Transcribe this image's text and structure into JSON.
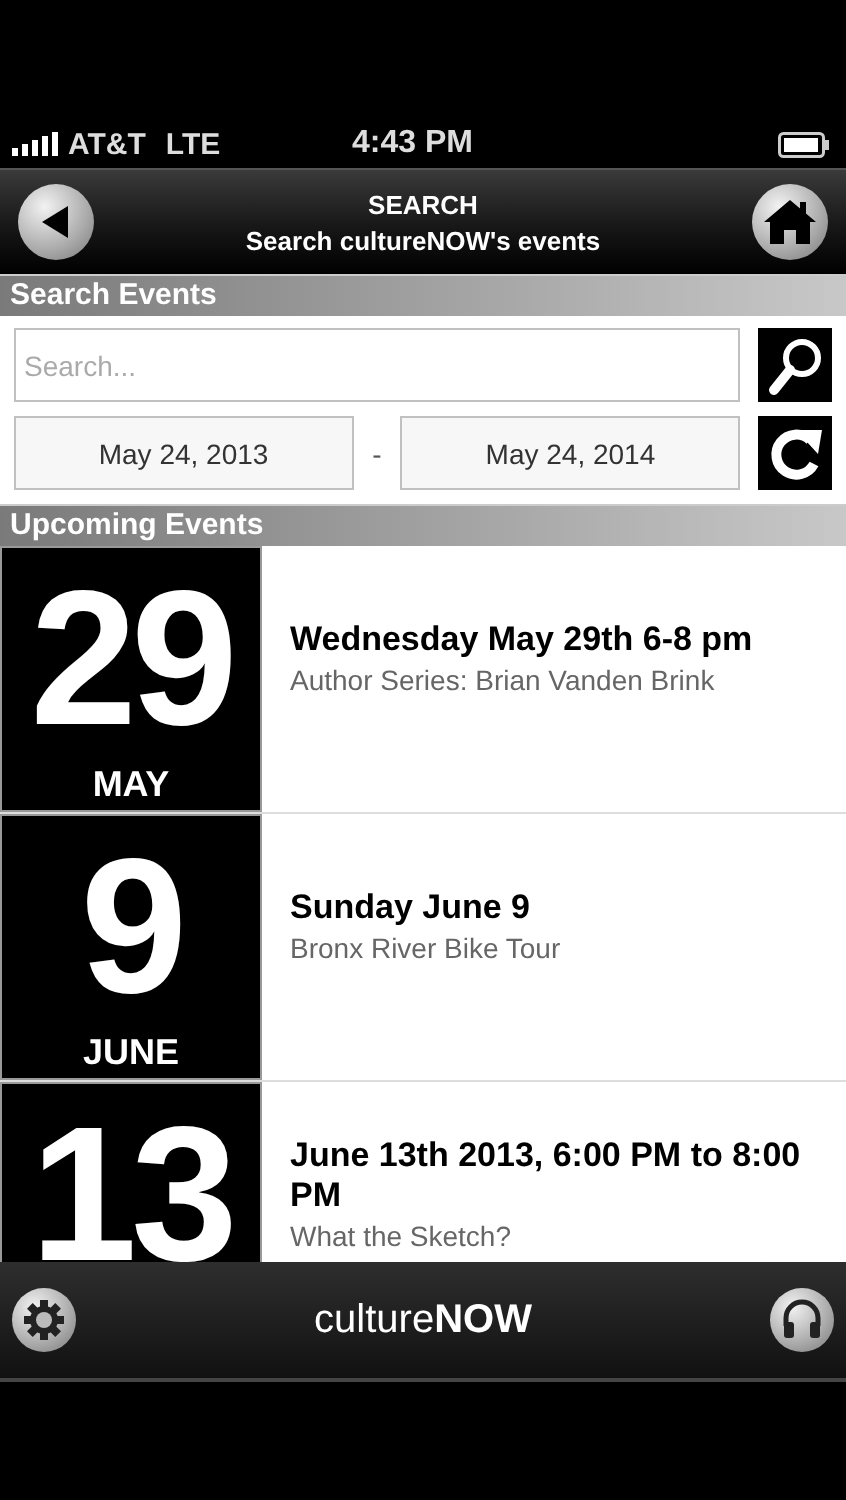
{
  "status_bar": {
    "carrier": "AT&T",
    "network": "LTE",
    "time": "4:43 PM"
  },
  "nav_bar": {
    "title": "SEARCH",
    "subtitle": "Search cultureNOW's events"
  },
  "search_section": {
    "heading": "Search Events",
    "search": {
      "placeholder": "Search..."
    },
    "date_from": "May 24, 2013",
    "separator": "-",
    "date_to": "May 24, 2014"
  },
  "events_section": {
    "heading": "Upcoming Events",
    "events": [
      {
        "day": "29",
        "month": "MAY",
        "title": "Wednesday May 29th 6-8 pm",
        "subtitle": "Author Series: Brian Vanden Brink"
      },
      {
        "day": "9",
        "month": "JUNE",
        "title": "Sunday June 9",
        "subtitle": "Bronx River Bike Tour"
      },
      {
        "day": "13",
        "title": "June 13th 2013, 6:00 PM to 8:00 PM",
        "subtitle": "What the Sketch?"
      }
    ]
  },
  "footer": {
    "logo": "culture**NOW**"
  }
}
